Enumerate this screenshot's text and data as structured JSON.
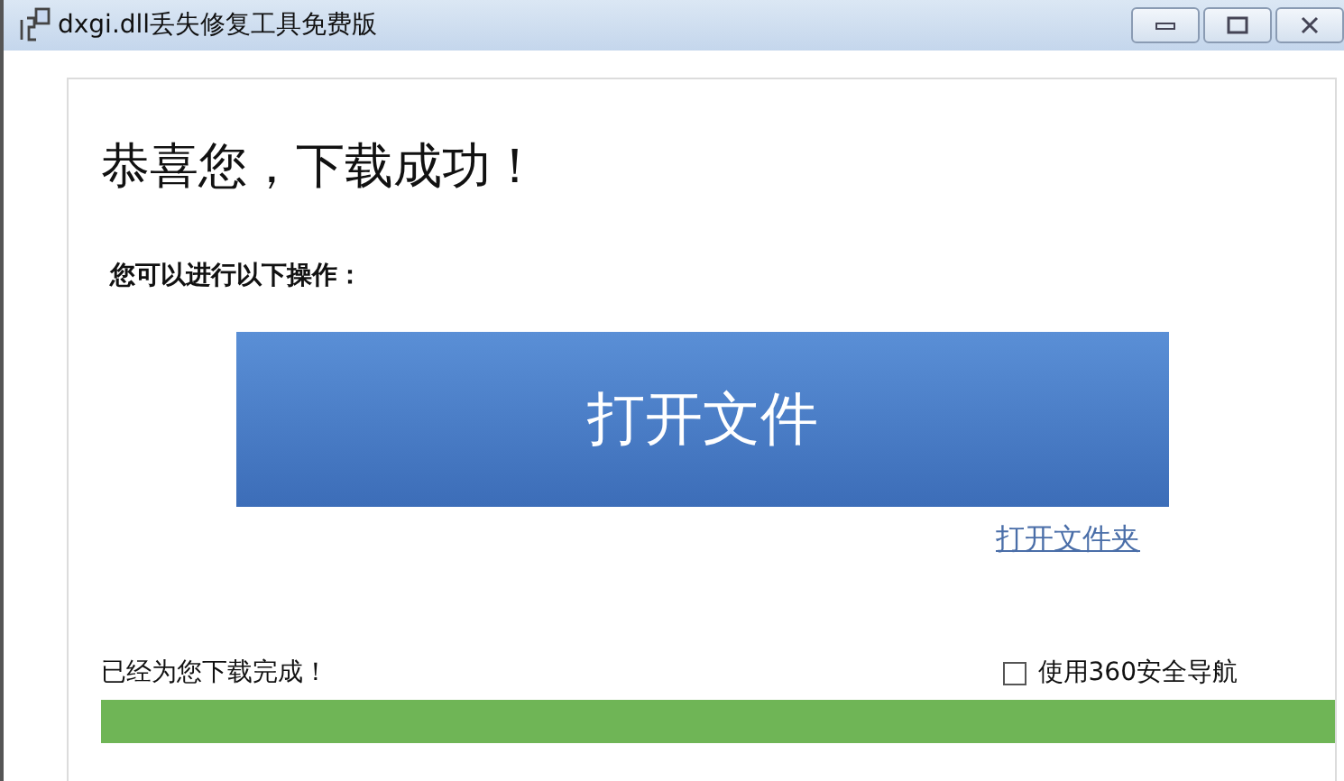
{
  "window": {
    "title": "dxgi.dll丢失修复工具免费版"
  },
  "heading": "恭喜您，下载成功！",
  "prompt": "您可以进行以下操作：",
  "open_button": "打开文件",
  "folder_link": "打开文件夹",
  "status": "已经为您下载完成！",
  "option": {
    "label": "使用360安全导航",
    "checked": false
  },
  "progress": {
    "level": 1
  }
}
